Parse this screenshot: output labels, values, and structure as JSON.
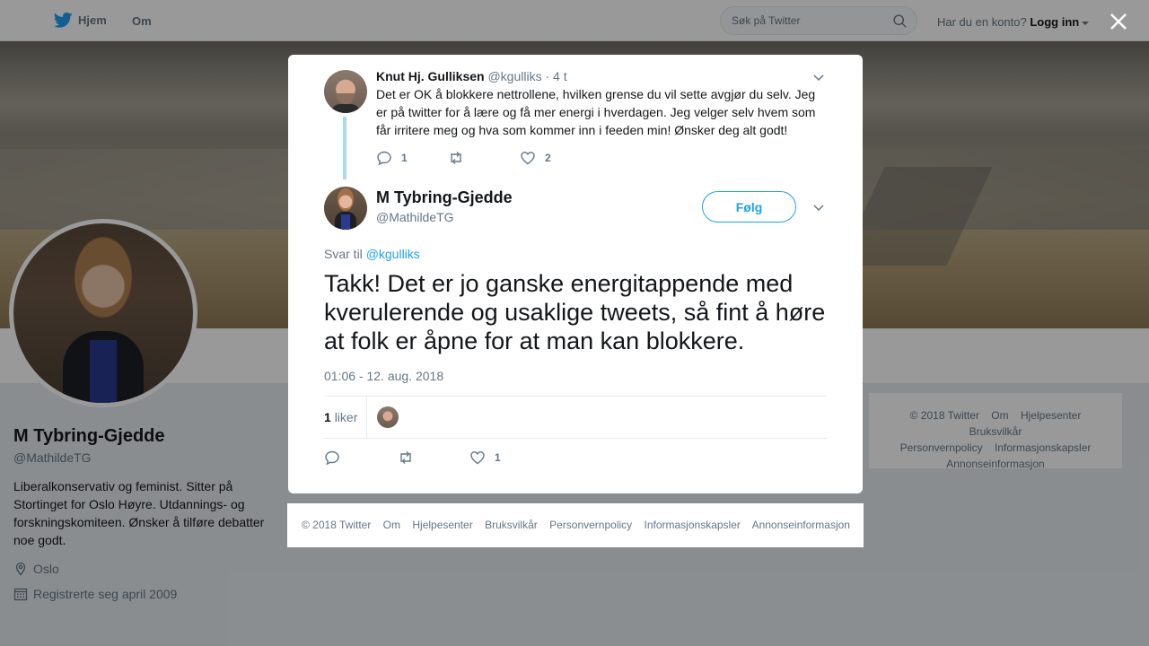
{
  "topbar": {
    "home_label": "Hjem",
    "about_label": "Om",
    "search_placeholder": "Søk på Twitter",
    "account_prompt": "Har du en konto?",
    "login_label": "Logg inn"
  },
  "profile": {
    "name": "M Tybring-Gjedde",
    "handle": "@MathildeTG",
    "bio": "Liberalkonservativ og feminist. Sitter på Stortinget for Oslo Høyre. Utdannings- og forskningskomiteen. Ønsker å tilføre debatter noe godt.",
    "location": "Oslo",
    "joined": "Registrerte seg april 2009"
  },
  "side_footer": {
    "items": [
      "© 2018 Twitter",
      "Om",
      "Hjelpesenter",
      "Bruksvilkår",
      "Personvernpolicy",
      "Informasjonskapsler",
      "Annonseinformasjon"
    ]
  },
  "parent_tweet": {
    "name": "Knut Hj. Gulliksen",
    "handle": "@kgulliks",
    "time": "· 4 t",
    "text": "Det er OK å blokkere nettrollene, hvilken grense du vil sette avgjør du selv. Jeg er på twitter for å lære og få mer energi i hverdagen. Jeg velger selv hvem som får irritere meg og hva som kommer inn i feeden min! Ønsker deg alt godt!",
    "reply_count": "1",
    "like_count": "2"
  },
  "main_tweet": {
    "name": "M Tybring-Gjedde",
    "handle": "@MathildeTG",
    "follow_label": "Følg",
    "reply_prefix": "Svar til",
    "reply_to": "@kgulliks",
    "text": "Takk! Det er jo ganske energitappende med kverulerende og usaklige tweets, så fint å høre at folk er åpne for at man kan blokkere.",
    "timestamp": "01:06 - 12. aug. 2018",
    "likes_count": "1",
    "likes_label": "liker",
    "like_action_count": "1"
  },
  "modal_footer": {
    "items": [
      "© 2018 Twitter",
      "Om",
      "Hjelpesenter",
      "Bruksvilkår",
      "Personvernpolicy",
      "Informasjonskapsler",
      "Annonseinformasjon"
    ]
  },
  "colors": {
    "accent": "#1da1f2",
    "thread_line": "#a8daf3",
    "muted_text": "#657786"
  },
  "icons": {
    "logo": "twitter-bird-icon",
    "search": "search-icon",
    "close": "close-icon",
    "location": "location-pin-icon",
    "calendar": "calendar-icon",
    "reply": "reply-icon",
    "retweet": "retweet-icon",
    "like": "heart-icon",
    "more": "chevron-down-icon"
  }
}
